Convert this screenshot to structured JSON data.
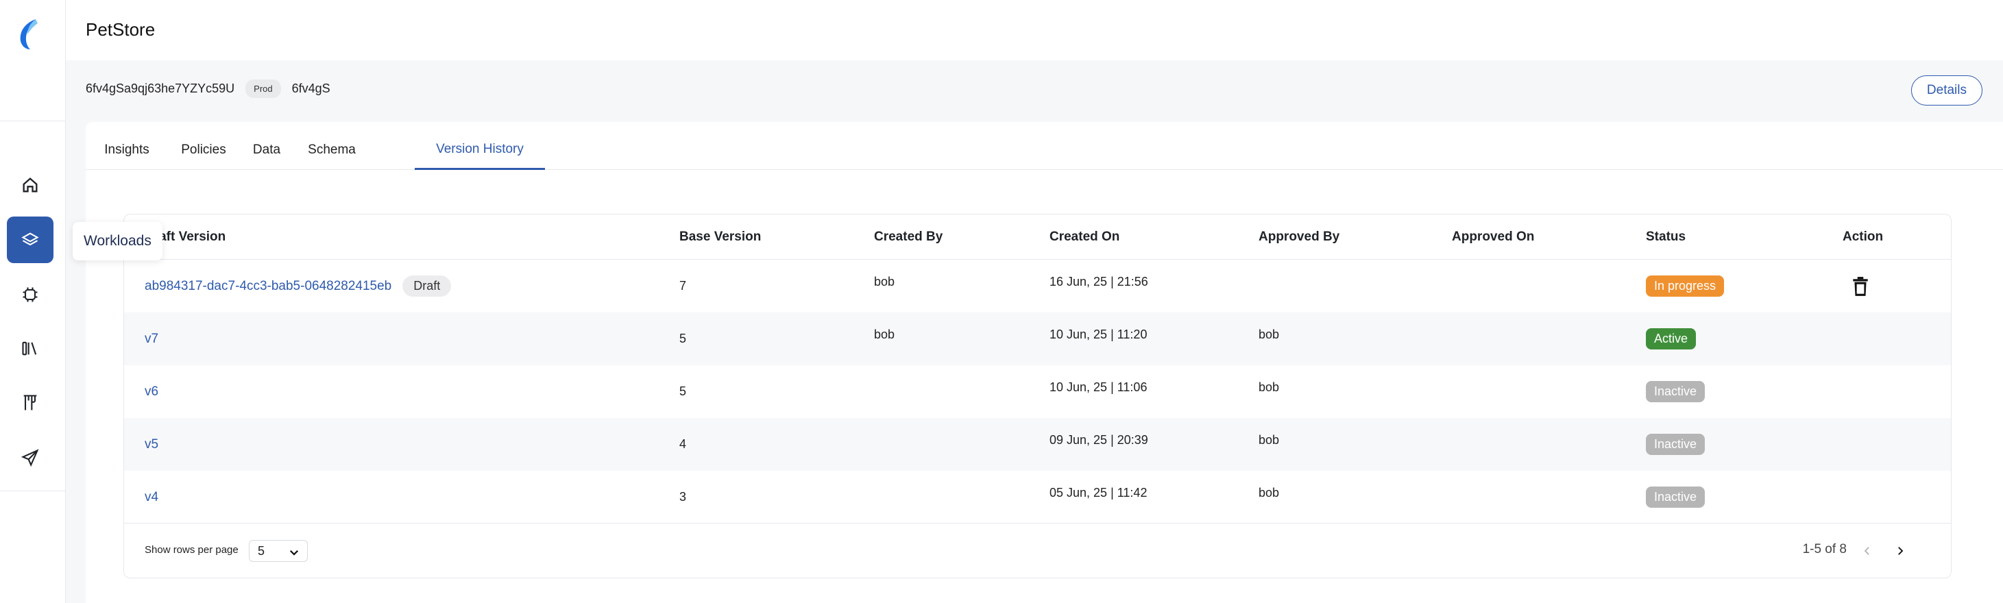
{
  "app": {
    "title": "PetStore"
  },
  "sidebar": {
    "logo": "app-logo",
    "items": [
      {
        "name": "home",
        "icon": "home-icon"
      },
      {
        "name": "workloads",
        "icon": "layers-icon",
        "active": true
      },
      {
        "name": "chip",
        "icon": "chip-icon"
      },
      {
        "name": "library",
        "icon": "library-icon"
      },
      {
        "name": "restaurant",
        "icon": "utensils-icon"
      },
      {
        "name": "send",
        "icon": "paper-plane-icon"
      }
    ],
    "tooltip": "Workloads"
  },
  "meta": {
    "id": "6fv4gSa9qj63he7YZYc59U",
    "env_badge": "Prod",
    "short_id": "6fv4gS",
    "details_label": "Details"
  },
  "tabs": [
    {
      "label": "Insights"
    },
    {
      "label": "Policies"
    },
    {
      "label": "Data"
    },
    {
      "label": "Schema"
    },
    {
      "label": "Version History",
      "active": true
    }
  ],
  "table": {
    "headers": [
      "Draft Version",
      "Base Version",
      "Created By",
      "Created On",
      "Approved By",
      "Approved On",
      "Status",
      "Action"
    ],
    "rows": [
      {
        "version": "ab984317-dac7-4cc3-bab5-0648282415eb",
        "chip": "Draft",
        "base": "7",
        "created_by": "bob",
        "created_on": "16 Jun, 25 | 21:56",
        "approved_by": "",
        "approved_on": "",
        "status": "In progress",
        "action": "trash-icon"
      },
      {
        "version": "v7",
        "chip": "",
        "base": "5",
        "created_by": "bob",
        "created_on": "10 Jun, 25 | 11:20",
        "approved_by": "bob",
        "approved_on": "",
        "status": "Active",
        "action": ""
      },
      {
        "version": "v6",
        "chip": "",
        "base": "5",
        "created_by": "",
        "created_on": "10 Jun, 25 | 11:06",
        "approved_by": "bob",
        "approved_on": "",
        "status": "Inactive",
        "action": ""
      },
      {
        "version": "v5",
        "chip": "",
        "base": "4",
        "created_by": "",
        "created_on": "09 Jun, 25 | 20:39",
        "approved_by": "bob",
        "approved_on": "",
        "status": "Inactive",
        "action": ""
      },
      {
        "version": "v4",
        "chip": "",
        "base": "3",
        "created_by": "",
        "created_on": "05 Jun, 25 | 11:42",
        "approved_by": "bob",
        "approved_on": "",
        "status": "Inactive",
        "action": ""
      }
    ],
    "status_colors": {
      "In progress": "#f0912f",
      "Active": "#3f8f3a",
      "Inactive": "#b5b5b5"
    }
  },
  "pagination": {
    "rows_label": "Show rows per page",
    "rows_value": "5",
    "range": "1-5 of 8"
  },
  "colors": {
    "accent": "#2e5aac"
  }
}
